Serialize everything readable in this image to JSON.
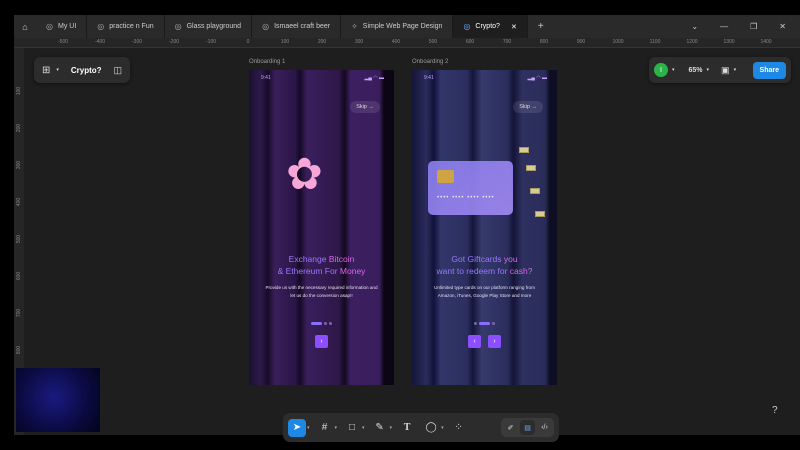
{
  "tabs": [
    {
      "label": "My UI",
      "icon": "figma-file-icon"
    },
    {
      "label": "practice n Fun",
      "icon": "figma-file-icon"
    },
    {
      "label": "Glass playground",
      "icon": "figma-file-icon"
    },
    {
      "label": "Ismaeel craft beer",
      "icon": "figma-file-icon"
    },
    {
      "label": "Simple Web Page Design",
      "icon": "figma-design-icon"
    },
    {
      "label": "Crypto?",
      "icon": "figma-file-icon",
      "active": true
    }
  ],
  "ruler_h": [
    "-500",
    "-400",
    "-300",
    "-200",
    "-100",
    "0",
    "100",
    "200",
    "300",
    "400",
    "500",
    "600",
    "700",
    "800",
    "900",
    "1000",
    "1100",
    "1200",
    "1300",
    "1400"
  ],
  "ruler_v": [
    "100",
    "200",
    "300",
    "400",
    "500",
    "600",
    "700",
    "800"
  ],
  "file_name": "Crypto?",
  "user_initial": "I",
  "zoom": "65%",
  "share_label": "Share",
  "frames": [
    {
      "label": "Onboarding 1",
      "time": "9:41",
      "skip": "Skip →",
      "title_a": "Exchange ",
      "title_b": "Bitcoin",
      "title_c": "& Ethereum For ",
      "title_d": "Money",
      "body": "Provide us with the necessary required information and let us do the conversion asap!!",
      "next": "›"
    },
    {
      "label": "Onboarding 2",
      "time": "9:41",
      "skip": "Skip →",
      "title_a": "Got Giftcards ",
      "title_b": "you",
      "title_c": "want to redeem for ",
      "title_d": "cash?",
      "body": "Unlimited type cards on our platform ranging from Amazon, iTunes, Google Play Store and more",
      "card_number": "•••• •••• •••• ••••",
      "prev": "‹",
      "next": "›"
    }
  ],
  "help": "?"
}
